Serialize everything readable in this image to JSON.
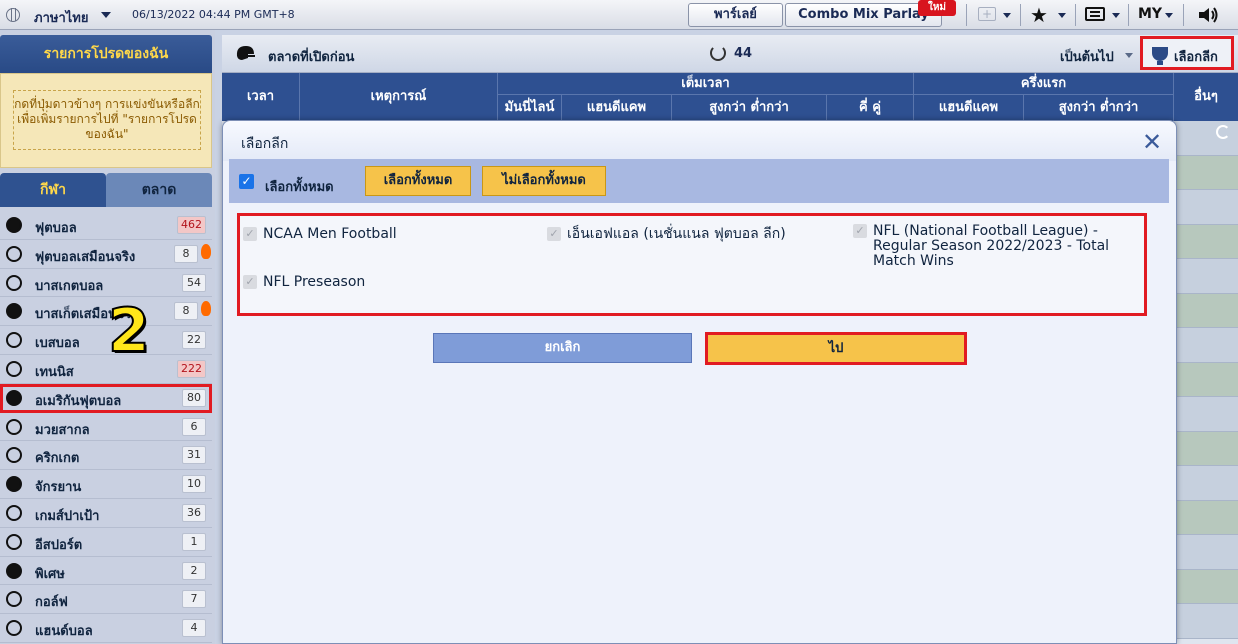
{
  "topbar": {
    "language": "ภาษาไทย",
    "datetime": "06/13/2022 04:44 PM GMT+8",
    "parlay_label": "พาร์เลย์",
    "combo_label": "Combo Mix Parlay",
    "new_badge": "ใหม่",
    "currency": "MY"
  },
  "sidebar": {
    "title": "รายการโปรดของฉัน",
    "fav_hint": "กดที่ปุ่มดาวข้างๆ การแข่งขันหรือลีกเพื่อเพิ่มรายการไปที่ \"รายการโปรดของฉัน\"",
    "tab_sport": "กีฬา",
    "tab_market": "ตลาด",
    "items": [
      {
        "label": "ฟุตบอล",
        "count": "462",
        "hot": true,
        "icon": "soccer-icon"
      },
      {
        "label": "ฟุตบอลเสมือนจริง",
        "count": "8",
        "flame": true,
        "icon": "virtual-soccer-icon"
      },
      {
        "label": "บาสเกตบอล",
        "count": "54",
        "icon": "basketball-icon"
      },
      {
        "label": "บาสเก็ตเสมือนจริง",
        "count": "8",
        "flame": true,
        "icon": "virtual-basketball-icon"
      },
      {
        "label": "เบสบอล",
        "count": "22",
        "icon": "baseball-icon"
      },
      {
        "label": "เทนนิส",
        "count": "222",
        "hot": true,
        "icon": "tennis-icon"
      },
      {
        "label": "อเมริกันฟุตบอล",
        "count": "80",
        "highlight": true,
        "icon": "football-helmet-icon"
      },
      {
        "label": "มวยสากล",
        "count": "6",
        "icon": "boxing-icon"
      },
      {
        "label": "คริกเกต",
        "count": "31",
        "icon": "cricket-icon"
      },
      {
        "label": "จักรยาน",
        "count": "10",
        "icon": "cycling-icon"
      },
      {
        "label": "เกมส์ปาเป้า",
        "count": "36",
        "icon": "darts-icon"
      },
      {
        "label": "อีสปอร์ต",
        "count": "1",
        "icon": "gamepad-icon"
      },
      {
        "label": "พิเศษ",
        "count": "2",
        "icon": "crown-icon"
      },
      {
        "label": "กอล์ฟ",
        "count": "7",
        "icon": "golf-icon"
      },
      {
        "label": "แฮนด์บอล",
        "count": "4",
        "icon": "handball-icon"
      }
    ],
    "step_number": "2"
  },
  "main": {
    "title": "ตลาดที่เปิดก่อน",
    "count": "44",
    "sort_label": "เป็นต้นไป",
    "select_league_label": "เลือกลีก",
    "table_headers": {
      "time": "เวลา",
      "event": "เหตุการณ์",
      "full_time": "เต็มเวลา",
      "first_half": "ครึ่งแรก",
      "other": "อื่นๆ",
      "moneyline": "มันนี่ไลน์",
      "handicap": "แฮนดีแคพ",
      "over_under": "สูงกว่า ต่ำกว่า",
      "odd_even": "คี่ คู่",
      "fh_handicap": "แฮนดีแคพ",
      "fh_over_under": "สูงกว่า ต่ำกว่า"
    }
  },
  "modal": {
    "title": "เลือกลีก",
    "select_all_check_label": "เลือกทั้งหมด",
    "select_all_btn": "เลือกทั้งหมด",
    "deselect_all_btn": "ไม่เลือกทั้งหมด",
    "leagues": [
      "NCAA Men Football",
      "เอ็นเอฟแอล (เนชั่นแนล ฟุตบอล ลีก)",
      "NFL (National Football League) - Regular Season 2022/2023 - Total Match Wins",
      "NFL Preseason"
    ],
    "cancel_label": "ยกเลิก",
    "go_label": "ไป"
  },
  "colors": {
    "header_blue": "#2e5091",
    "highlight_red": "#e11b22",
    "button_yellow": "#f6c34a",
    "sidebar_title_text": "#ffd84a"
  }
}
